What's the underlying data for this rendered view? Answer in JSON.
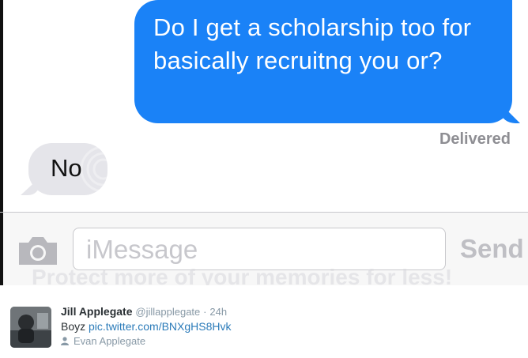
{
  "conversation": {
    "sent_message": "Do I get a scholarship too for basically recruitng you or?",
    "delivery_status": "Delivered",
    "received_message": "No"
  },
  "composer": {
    "placeholder": "iMessage",
    "send_label": "Send",
    "overlay_text": "Protect more of your memories for less!",
    "camera_icon": "camera-icon"
  },
  "tweet": {
    "display_name": "Jill Applegate",
    "handle": "@jillapplegate",
    "separator": "·",
    "time": "24h",
    "text": "Boyz",
    "link": "pic.twitter.com/BNXgHS8Hvk",
    "mention_user": "Evan Applegate",
    "person_icon": "person-icon"
  },
  "colors": {
    "sent_bubble": "#1a82f7",
    "received_bubble": "#e5e5ea",
    "link": "#2b7bb9",
    "muted": "#8899a6"
  }
}
